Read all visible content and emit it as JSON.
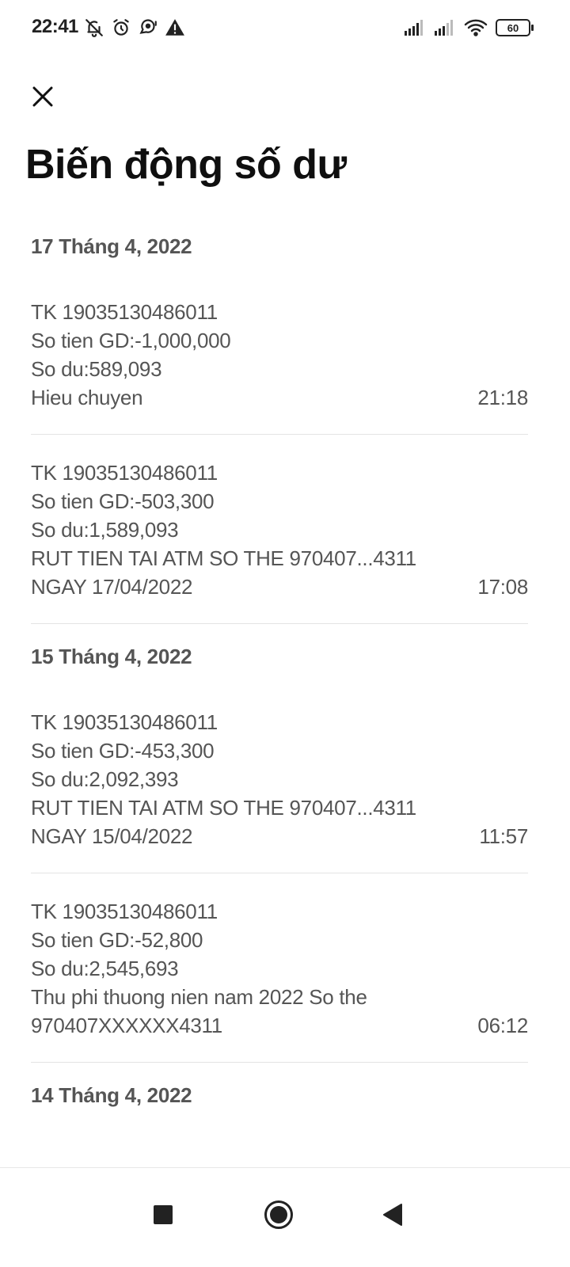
{
  "status_bar": {
    "time": "22:41",
    "left_icons": [
      "bell-off-icon",
      "alarm-icon",
      "chat-bubble-icon",
      "warning-icon"
    ],
    "battery": "60"
  },
  "header": {
    "close_icon": "close-icon",
    "title": "Biến động số dư"
  },
  "groups": [
    {
      "date": "17 Tháng 4, 2022",
      "transactions": [
        {
          "lines": [
            "TK 19035130486011",
            "So tien GD:-1,000,000",
            "So du:589,093"
          ],
          "last_line": "Hieu chuyen",
          "time": "21:18"
        },
        {
          "lines": [
            "TK 19035130486011",
            "So tien GD:-503,300",
            "So du:1,589,093",
            "RUT TIEN TAI ATM SO THE 970407...4311"
          ],
          "last_line": "NGAY 17/04/2022",
          "time": "17:08"
        }
      ]
    },
    {
      "date": "15 Tháng 4, 2022",
      "transactions": [
        {
          "lines": [
            "TK 19035130486011",
            "So tien GD:-453,300",
            "So du:2,092,393",
            "RUT TIEN TAI ATM SO THE 970407...4311"
          ],
          "last_line": "NGAY 15/04/2022",
          "time": "11:57"
        },
        {
          "lines": [
            "TK 19035130486011",
            "So tien GD:-52,800",
            "So du:2,545,693",
            "Thu phi thuong nien nam 2022 So the"
          ],
          "last_line": "970407XXXXXX4311",
          "time": "06:12"
        }
      ]
    },
    {
      "date": "14 Tháng 4, 2022",
      "transactions": []
    }
  ],
  "nav": {
    "recent_icon": "square-icon",
    "home_icon": "circle-icon",
    "back_icon": "triangle-back-icon"
  }
}
